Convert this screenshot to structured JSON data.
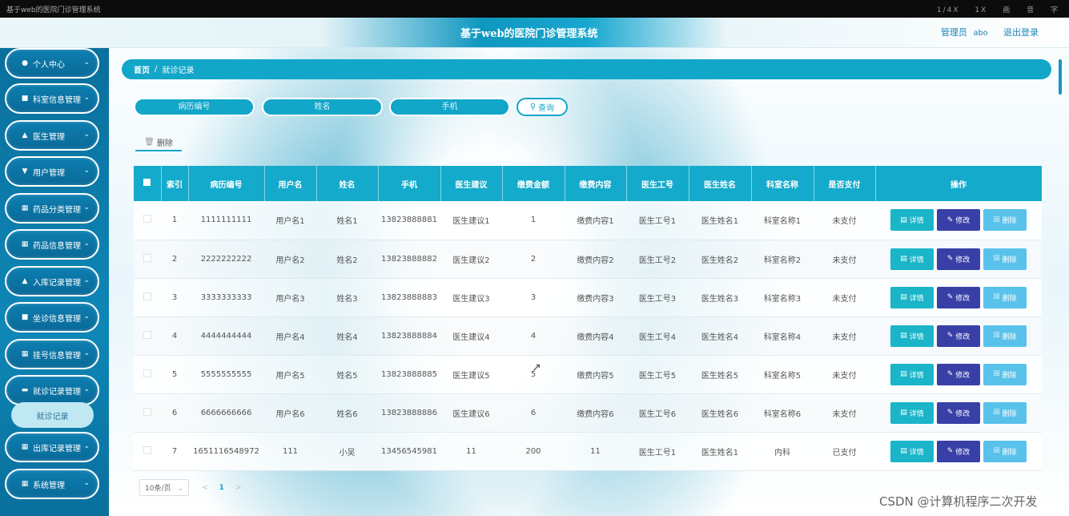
{
  "window": {
    "title": "基于web的医院门诊管理系统",
    "controls": [
      "1/4X",
      "1X",
      "画",
      "音",
      "字"
    ]
  },
  "header": {
    "system_name": "基于web的医院门诊管理系统",
    "role": "管理员",
    "username": "abo",
    "logout": "退出登录"
  },
  "sidebar": {
    "items": [
      {
        "label": "个人中心",
        "icon": "user-icon"
      },
      {
        "label": "科室信息管理",
        "icon": "building-icon"
      },
      {
        "label": "医生管理",
        "icon": "doctor-icon"
      },
      {
        "label": "用户管理",
        "icon": "users-icon"
      },
      {
        "label": "药品分类管理",
        "icon": "grid-icon"
      },
      {
        "label": "药品信息管理",
        "icon": "grid-icon"
      },
      {
        "label": "入库记录管理",
        "icon": "inbox-icon"
      },
      {
        "label": "坐诊信息管理",
        "icon": "clinic-icon"
      },
      {
        "label": "挂号信息管理",
        "icon": "grid-icon"
      },
      {
        "label": "就诊记录管理",
        "icon": "record-icon"
      },
      {
        "label": "出库记录管理",
        "icon": "grid-icon"
      },
      {
        "label": "系统管理",
        "icon": "grid-icon"
      }
    ],
    "active_sub": "就诊记录"
  },
  "breadcrumb": {
    "home": "首页",
    "separator": "/",
    "current": "就诊记录"
  },
  "search": {
    "field1_placeholder": "病历编号",
    "field2_placeholder": "姓名",
    "field3_placeholder": "手机",
    "button": "查询"
  },
  "toolbar": {
    "delete": "删除"
  },
  "table": {
    "headers": [
      "索引",
      "病历编号",
      "用户名",
      "姓名",
      "手机",
      "医生建议",
      "缴费金额",
      "缴费内容",
      "医生工号",
      "医生姓名",
      "科室名称",
      "是否支付",
      "操作"
    ],
    "rows": [
      [
        "1",
        "1111111111",
        "用户名1",
        "姓名1",
        "13823888881",
        "医生建议1",
        "1",
        "缴费内容1",
        "医生工号1",
        "医生姓名1",
        "科室名称1",
        "未支付"
      ],
      [
        "2",
        "2222222222",
        "用户名2",
        "姓名2",
        "13823888882",
        "医生建议2",
        "2",
        "缴费内容2",
        "医生工号2",
        "医生姓名2",
        "科室名称2",
        "未支付"
      ],
      [
        "3",
        "3333333333",
        "用户名3",
        "姓名3",
        "13823888883",
        "医生建议3",
        "3",
        "缴费内容3",
        "医生工号3",
        "医生姓名3",
        "科室名称3",
        "未支付"
      ],
      [
        "4",
        "4444444444",
        "用户名4",
        "姓名4",
        "13823888884",
        "医生建议4",
        "4",
        "缴费内容4",
        "医生工号4",
        "医生姓名4",
        "科室名称4",
        "未支付"
      ],
      [
        "5",
        "5555555555",
        "用户名5",
        "姓名5",
        "13823888885",
        "医生建议5",
        "5",
        "缴费内容5",
        "医生工号5",
        "医生姓名5",
        "科室名称5",
        "未支付"
      ],
      [
        "6",
        "6666666666",
        "用户名6",
        "姓名6",
        "13823888886",
        "医生建议6",
        "6",
        "缴费内容6",
        "医生工号6",
        "医生姓名6",
        "科室名称6",
        "未支付"
      ],
      [
        "7",
        "1651116548972",
        "111",
        "小吴",
        "13456545981",
        "11",
        "200",
        "11",
        "医生工号1",
        "医生姓名1",
        "内科",
        "已支付"
      ]
    ],
    "actions": {
      "detail": "详情",
      "edit": "修改",
      "delete": "删除"
    }
  },
  "pagination": {
    "page_size": "10条/页",
    "current_page": "1",
    "prev": "<",
    "next": ">"
  },
  "watermark": "CSDN @计算机程序二次开发"
}
